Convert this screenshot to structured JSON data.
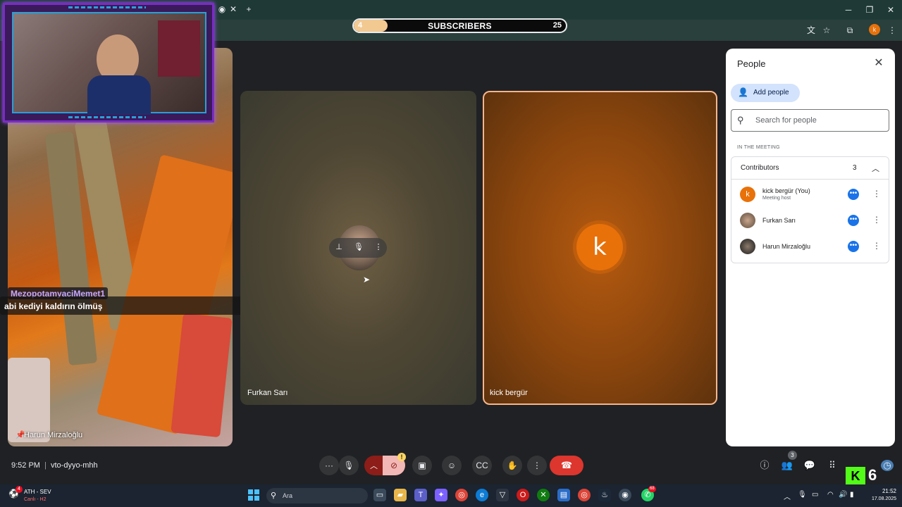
{
  "subscribers": {
    "current": "4",
    "label": "SUBSCRIBERS",
    "goal": "25",
    "progress_fraction": 0.16
  },
  "chat": {
    "user": "MezopotamyaciMemet1",
    "message": "abi kediyi kaldırın ölmüş"
  },
  "tiles": {
    "harun": {
      "name": "Harun Mirzaloğlu"
    },
    "furkan": {
      "name": "Furkan Sarı"
    },
    "kick": {
      "name": "kick bergür",
      "initial": "k"
    }
  },
  "people_panel": {
    "title": "People",
    "add_people": "Add people",
    "search_placeholder": "Search for people",
    "section_label": "IN THE MEETING",
    "group_label": "Contributors",
    "group_count": "3",
    "participants": [
      {
        "name": "kick bergür (You)",
        "role": "Meeting host",
        "initial": "k",
        "color": "#e8710a"
      },
      {
        "name": "Furkan Sarı",
        "role": "",
        "initial": "",
        "color": "#8a7a6a"
      },
      {
        "name": "Harun Mirzaloğlu",
        "role": "",
        "initial": "",
        "color": "#3a3a3a"
      }
    ]
  },
  "meeting": {
    "time": "9:52 PM",
    "separator": "|",
    "code": "vto-dyyo-mhh",
    "people_count": "3",
    "warning": "!"
  },
  "kick_widget": {
    "count": "6",
    "logo": "K"
  },
  "taskbar": {
    "weather_badge": "4",
    "match": "ATH - SEV",
    "status": "Canlı - H2",
    "search": "Ara",
    "time": "21:52",
    "date": "17.08.2025",
    "whatsapp_badge": "68"
  },
  "colors": {
    "accent": "#1a73e8",
    "end_call": "#dc362e",
    "kick_green": "#53fc18",
    "tile_highlight": "#f7b58a"
  }
}
